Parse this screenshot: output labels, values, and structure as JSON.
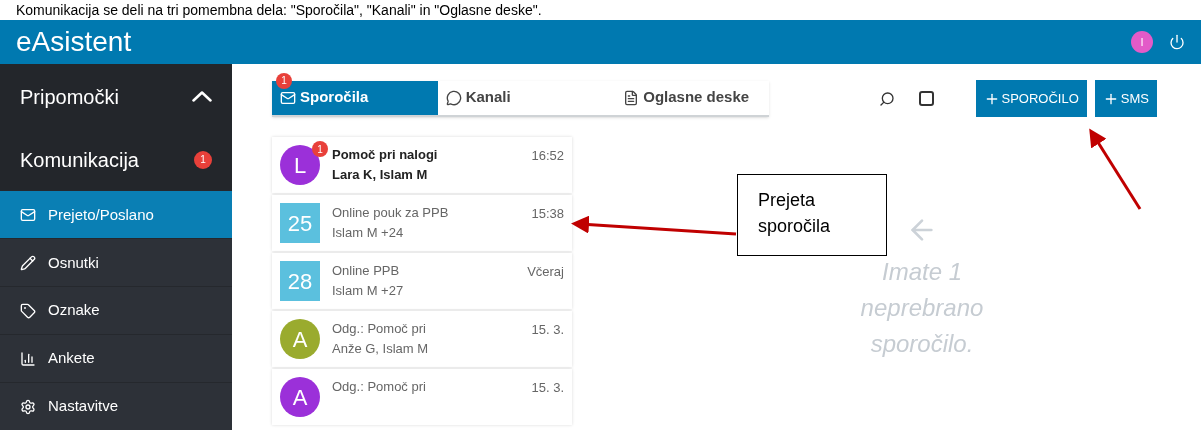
{
  "caption": "Komunikacija se deli na tri pomembna dela: \"Sporočila\", \"Kanali\" in \"Oglasne deske\".",
  "header": {
    "title": "eAsistent",
    "user_initial": "I"
  },
  "sidebar": {
    "section": {
      "label": "Pripomočki",
      "expanded": true
    },
    "group": {
      "label": "Komunikacija",
      "badge": "1"
    },
    "items": [
      {
        "label": "Prejeto/Poslano",
        "selected": true
      },
      {
        "label": "Osnutki",
        "selected": false
      },
      {
        "label": "Oznake",
        "selected": false
      },
      {
        "label": "Ankete",
        "selected": false
      },
      {
        "label": "Nastavitve",
        "selected": false
      }
    ]
  },
  "tabs": [
    {
      "label": "Sporočila",
      "badge": "1",
      "selected": true
    },
    {
      "label": "Kanali",
      "selected": false
    },
    {
      "label": "Oglasne deske",
      "selected": false
    }
  ],
  "toolbar": {
    "select_all": {
      "checked": false
    },
    "buttons": [
      "SPOROČILO",
      "SMS"
    ]
  },
  "messages": [
    {
      "avatar": "L",
      "kind": "circle",
      "color": "#9b30d9",
      "badge": "1",
      "unread": true,
      "title": "Pomoč pri nalogi",
      "people": "Lara K, Islam M",
      "time": "16:52"
    },
    {
      "avatar": "25",
      "kind": "square",
      "color": "#5bc0de",
      "unread": false,
      "title": "Online pouk za PPB",
      "people": "Islam M +24",
      "time": "15:38"
    },
    {
      "avatar": "28",
      "kind": "square",
      "color": "#5bc0de",
      "unread": false,
      "title": "Online PPB",
      "people": "Islam M +27",
      "time": "Včeraj"
    },
    {
      "avatar": "A",
      "kind": "circle",
      "color": "#9aab2e",
      "unread": false,
      "title": "Odg.: Pomoč pri",
      "people": "Anže G, Islam M",
      "time": "15. 3."
    },
    {
      "avatar": "A",
      "kind": "circle",
      "color": "#9b30d9",
      "unread": false,
      "title": "Odg.: Pomoč pri",
      "time": "15. 3."
    }
  ],
  "empty_state": "Imate 1 neprebrano sporočilo.",
  "callout": "Prejeta sporočila"
}
